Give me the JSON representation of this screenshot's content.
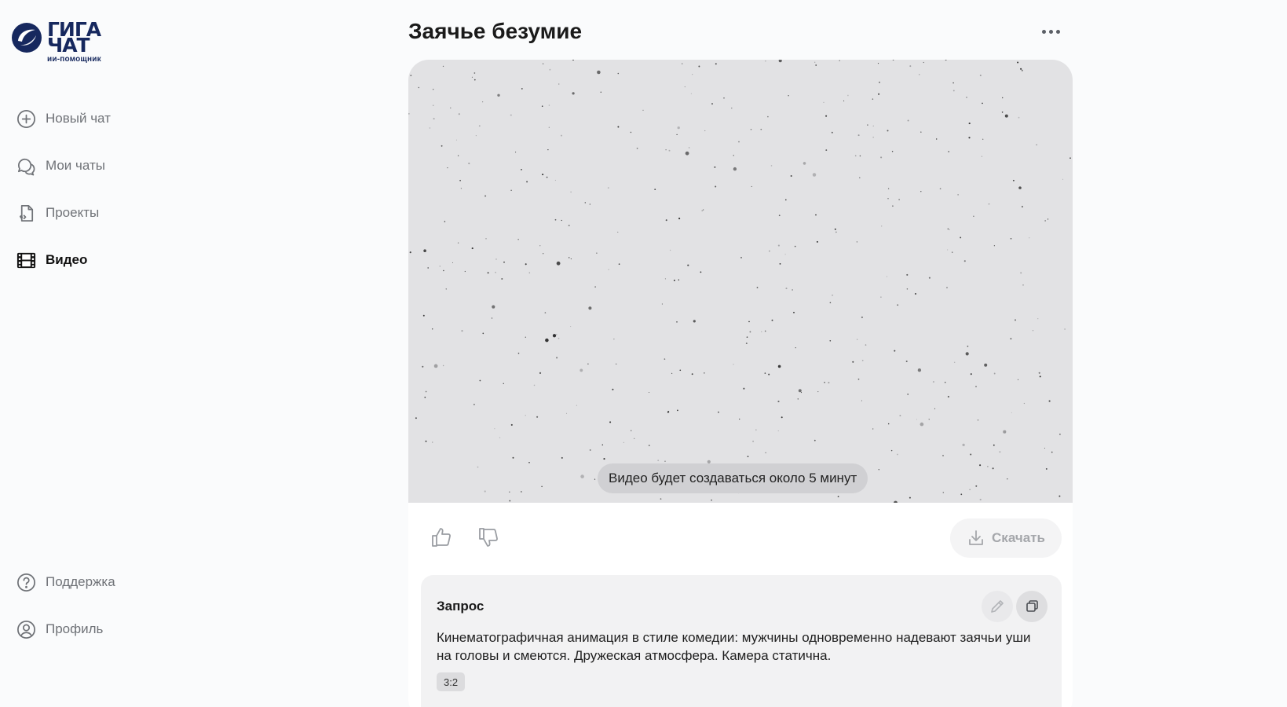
{
  "logo": {
    "line1": "ГИГА",
    "line2": "ЧАТ",
    "subtitle": "ии-помощник"
  },
  "sidebar": {
    "items": [
      {
        "label": "Новый чат",
        "icon": "plus-circle-icon"
      },
      {
        "label": "Мои чаты",
        "icon": "chat-bubbles-icon"
      },
      {
        "label": "Проекты",
        "icon": "project-doc-icon"
      },
      {
        "label": "Видео",
        "icon": "film-icon",
        "active": true
      }
    ],
    "bottom": [
      {
        "label": "Поддержка",
        "icon": "question-circle-icon"
      },
      {
        "label": "Профиль",
        "icon": "user-circle-icon"
      }
    ]
  },
  "main": {
    "title": "Заячье безумие",
    "video": {
      "status": "Видео будет создаваться около 5 минут"
    },
    "actions": {
      "download_label": "Скачать"
    },
    "request": {
      "title": "Запрос",
      "text": "Кинематографичная анимация в стиле комедии: мужчины одновременно надевают заячьи уши на головы и смеются. Дружеская атмосфера. Камера статична.",
      "aspect_ratio": "3:2"
    }
  },
  "colors": {
    "brand": "#16285e",
    "page_bg": "#fafbfc",
    "video_bg": "#e2e2e4"
  }
}
